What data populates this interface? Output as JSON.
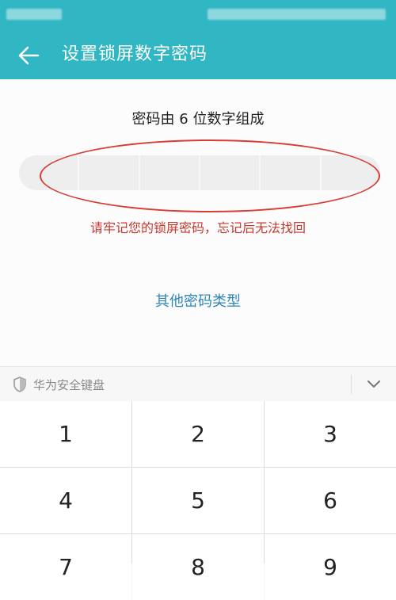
{
  "header": {
    "title": "设置锁屏数字密码"
  },
  "content": {
    "instruction": "密码由 6 位数字组成",
    "pin_cells": 6,
    "warning": "请牢记您的锁屏密码，忘记后无法找回",
    "other_types_link": "其他密码类型"
  },
  "keyboard": {
    "title": "华为安全键盘",
    "keys": [
      "1",
      "2",
      "3",
      "4",
      "5",
      "6",
      "7",
      "8",
      "9"
    ]
  },
  "colors": {
    "header_bg": "#31b6c4",
    "warning": "#c6392f",
    "link": "#2e86b8",
    "annotation_ellipse": "#d73c35"
  },
  "icons": {
    "back": "arrow-left-icon",
    "shield": "shield-icon",
    "collapse": "chevron-down-icon"
  }
}
